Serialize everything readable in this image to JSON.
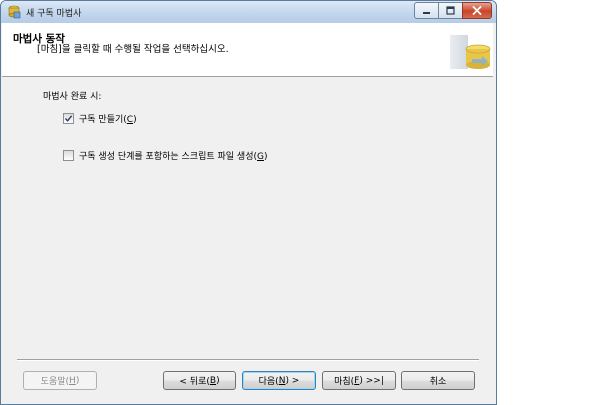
{
  "window": {
    "title": "새 구독 마법사",
    "controls": {
      "minimize": "minimize",
      "maximize": "maximize",
      "close": "close"
    }
  },
  "header": {
    "title": "마법사 동작",
    "description": "[마침]을 클릭할 때 수행될 작업을 선택하십시오."
  },
  "body": {
    "label": "마법사 완료 시:",
    "options": [
      {
        "label": "구독 만들기(",
        "key": "C",
        "suffix": ")",
        "checked": true
      },
      {
        "label": "구독 생성 단계를 포함하는 스크립트 파일 생성(",
        "key": "G",
        "suffix": ")",
        "checked": false
      }
    ]
  },
  "buttons": {
    "help": {
      "text": "도움말(",
      "key": "H",
      "suffix": ")",
      "enabled": false
    },
    "back": {
      "text": "< 뒤로(",
      "key": "B",
      "suffix": ")"
    },
    "next": {
      "text": "다음(",
      "key": "N",
      "suffix": ") >"
    },
    "finish": {
      "text": "마침(",
      "key": "F",
      "suffix": ") >>|"
    },
    "cancel": {
      "text": "취소"
    }
  },
  "colors": {
    "accent": "#3c7fb1",
    "close_button": "#c8442b",
    "titlebar": "#c4d8ee"
  }
}
